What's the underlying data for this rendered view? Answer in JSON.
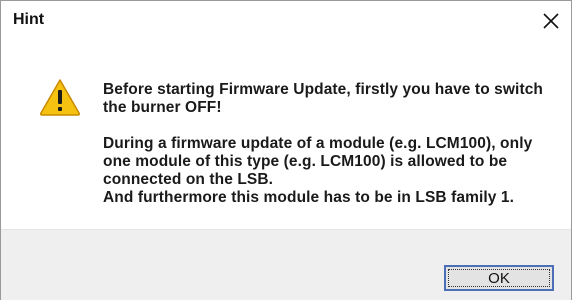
{
  "window": {
    "title": "Hint",
    "close_glyph": "✕"
  },
  "icons": {
    "warning": "warning-icon",
    "close": "close-icon"
  },
  "message": {
    "paragraph1": [
      "Before starting Firmware Update, firstly you have to switch",
      "the burner OFF!"
    ],
    "paragraph2": [
      "During a firmware update of a module (e.g. LCM100), only",
      "one module of this type (e.g. LCM100) is allowed to be",
      "connected on the LSB.",
      "And furthermore this module has to be in LSB family 1."
    ]
  },
  "buttons": {
    "ok_label": "OK"
  },
  "colors": {
    "warning_fill": "#f5c211",
    "warning_outline": "#c98a00",
    "footer_bg": "#efefef",
    "button_focus_border": "#4c6fb8"
  }
}
